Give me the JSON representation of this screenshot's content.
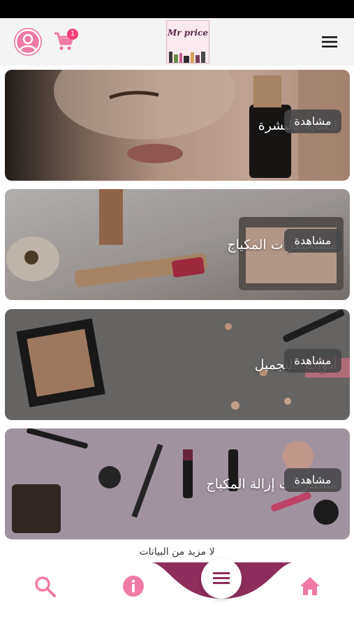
{
  "header": {
    "cart_count": "1",
    "logo_text": "Mr price",
    "avatar_icon": "user-avatar-icon",
    "cart_icon": "cart-icon",
    "menu_icon": "hamburger-menu-icon"
  },
  "categories": [
    {
      "title": "العناية بالبشرة",
      "button": "مشاهدة"
    },
    {
      "title": "مستحضرات المكياج",
      "button": "مشاهدة"
    },
    {
      "title": "أدوات  التجميل",
      "button": "مشاهدة"
    },
    {
      "title": "مستلزمات إزالة المكياج",
      "button": "مشاهدة"
    }
  ],
  "footer": {
    "no_more": "لا مزيد من البيانات"
  },
  "tabs": {
    "search_icon": "search-icon",
    "info_icon": "info-icon",
    "center_icon": "list-menu-icon",
    "home_icon": "home-icon"
  },
  "colors": {
    "accent": "#f07aa5",
    "accent_dark": "#8c2d5b",
    "badge": "#f4417a"
  }
}
